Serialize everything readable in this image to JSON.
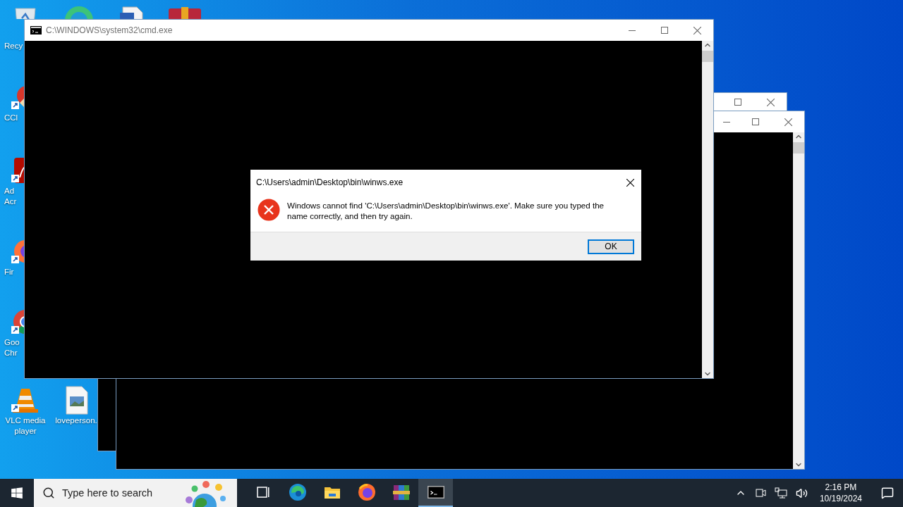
{
  "desktop": {
    "icons": [
      {
        "kind": "ccleaner",
        "lines": [
          "CCl"
        ],
        "shortcut": true
      },
      {
        "kind": "acrobat",
        "lines": [
          "Ad",
          "Acr"
        ],
        "shortcut": true
      },
      {
        "kind": "firefox",
        "lines": [
          "Fir"
        ],
        "shortcut": true
      },
      {
        "kind": "chrome",
        "lines": [
          "Goo",
          "Chr"
        ],
        "shortcut": true
      },
      {
        "kind": "vlc",
        "lines": [
          "VLC media",
          "player"
        ],
        "shortcut": true
      },
      {
        "kind": "image",
        "lines": [
          "loveperson."
        ],
        "shortcut": false
      }
    ],
    "recycle_label": "Recy"
  },
  "console_window": {
    "title": "C:\\WINDOWS\\system32\\cmd.exe",
    "active": false
  },
  "dialog": {
    "title": "C:\\Users\\admin\\Desktop\\bin\\winws.exe",
    "message": "Windows cannot find 'C:\\Users\\admin\\Desktop\\bin\\winws.exe'. Make sure you typed the name correctly, and then try again.",
    "button": "OK"
  },
  "taskbar": {
    "search": {
      "placeholder": "Type here to search"
    },
    "apps": [
      {
        "kind": "taskview",
        "selected": false
      },
      {
        "kind": "edge",
        "selected": false
      },
      {
        "kind": "explorer",
        "selected": false
      },
      {
        "kind": "firefox",
        "selected": false
      },
      {
        "kind": "winrar",
        "selected": false
      },
      {
        "kind": "cmd",
        "selected": true
      }
    ],
    "clock": {
      "time": "2:16 PM",
      "date": "10/19/2024"
    }
  }
}
